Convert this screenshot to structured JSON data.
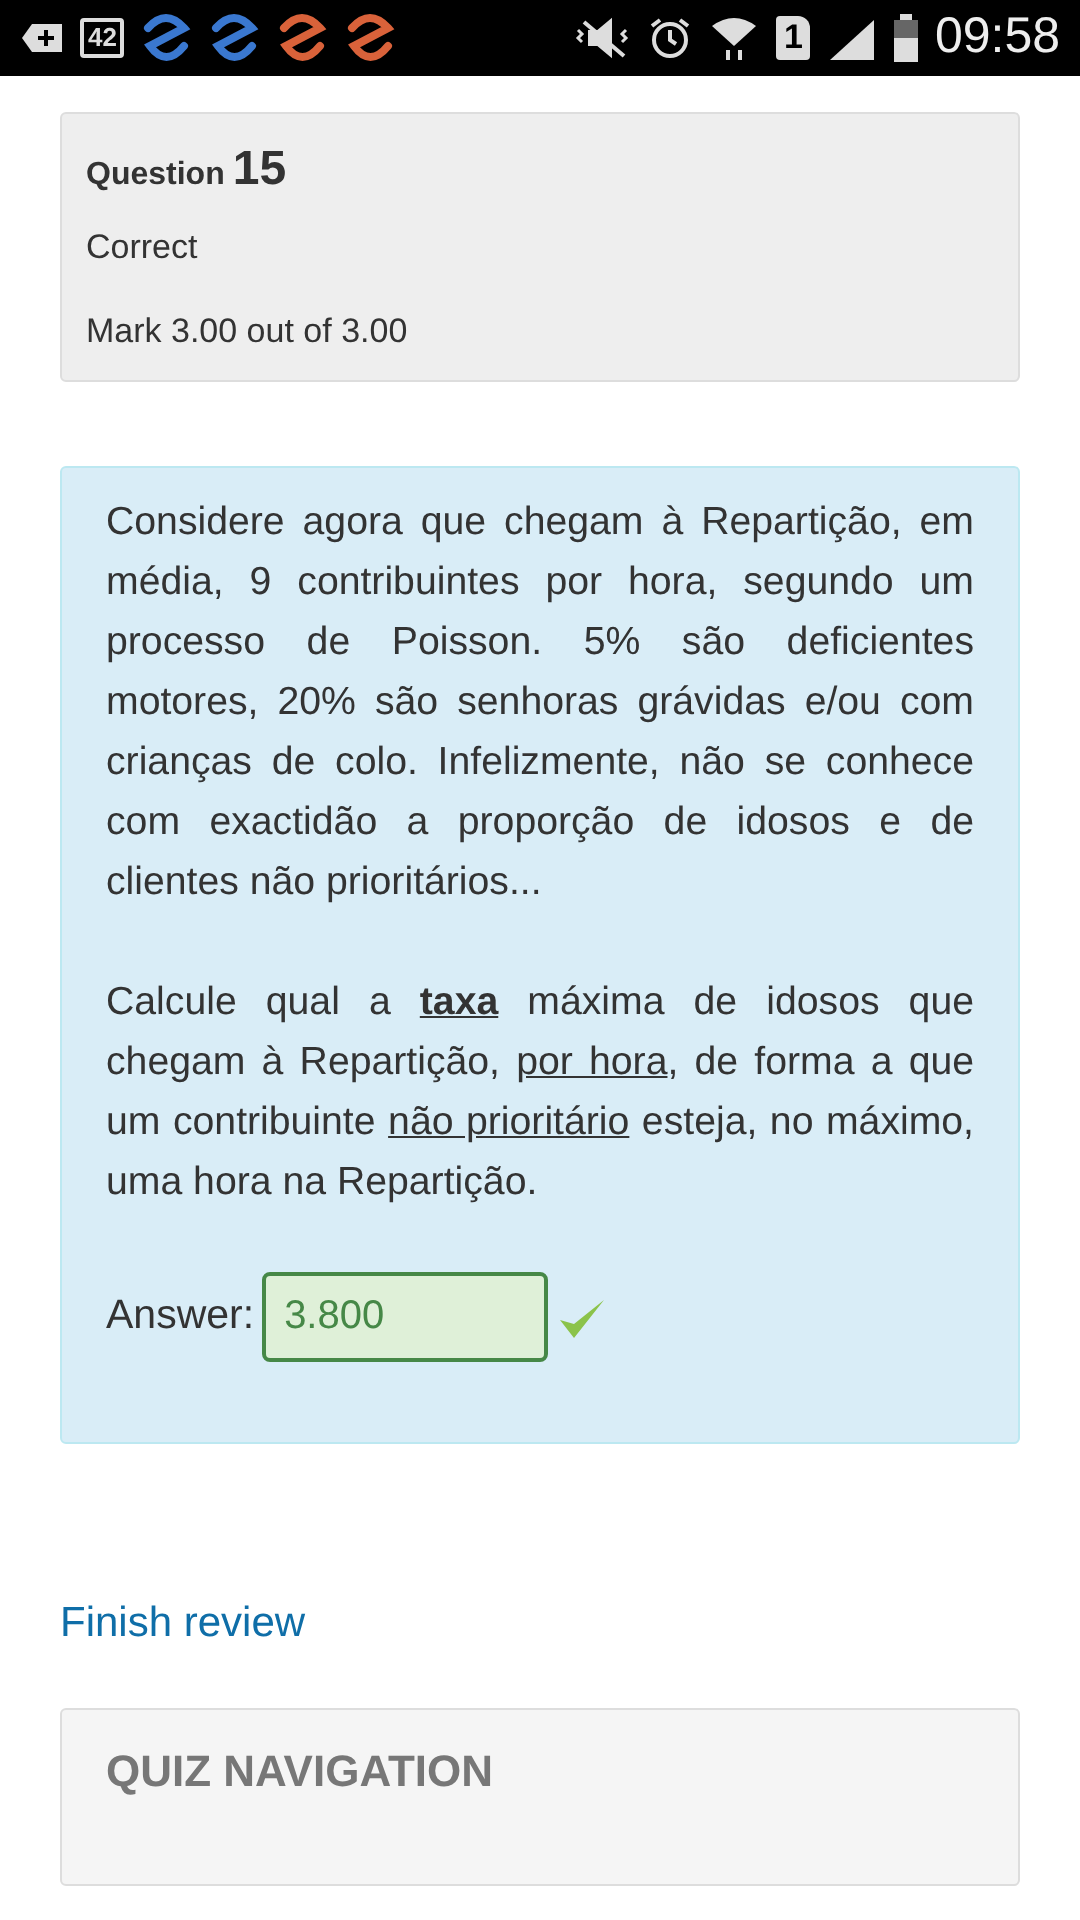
{
  "status_bar": {
    "battery_notification": "42",
    "sim": "1",
    "time": "09:58"
  },
  "question_info": {
    "label": "Question",
    "number": "15",
    "state": "Correct",
    "grade": "Mark 3.00 out of 3.00"
  },
  "formulation": {
    "paragraphs": [
      [
        {
          "text": "Considere agora que chegam à Repartição, em média, 9 contribuintes por hora, segundo um processo de Poisson. 5% são deficientes motores, 20% são senhoras grávidas e/ou com crianças de colo. Infelizmente, não se conhece com exactidão a proporção de idosos e de clientes não prioritários...",
          "bold": false,
          "underline": false
        }
      ],
      [
        {
          "text": "Calcule qual a ",
          "bold": false,
          "underline": false
        },
        {
          "text": "taxa",
          "bold": true,
          "underline": true
        },
        {
          "text": " máxima de idosos que chegam à Repartição, ",
          "bold": false,
          "underline": false
        },
        {
          "text": "por hora",
          "bold": false,
          "underline": true
        },
        {
          "text": ", de forma a que um contribuinte ",
          "bold": false,
          "underline": false
        },
        {
          "text": "não prioritário",
          "bold": false,
          "underline": true
        },
        {
          "text": " esteja, no máximo, uma hora na Repartição.",
          "bold": false,
          "underline": false
        }
      ]
    ],
    "answer_label": "Answer:",
    "answer_value": "3.800",
    "correct": true
  },
  "finish_review": "Finish review",
  "quiz_navigation": "QUIZ NAVIGATION"
}
